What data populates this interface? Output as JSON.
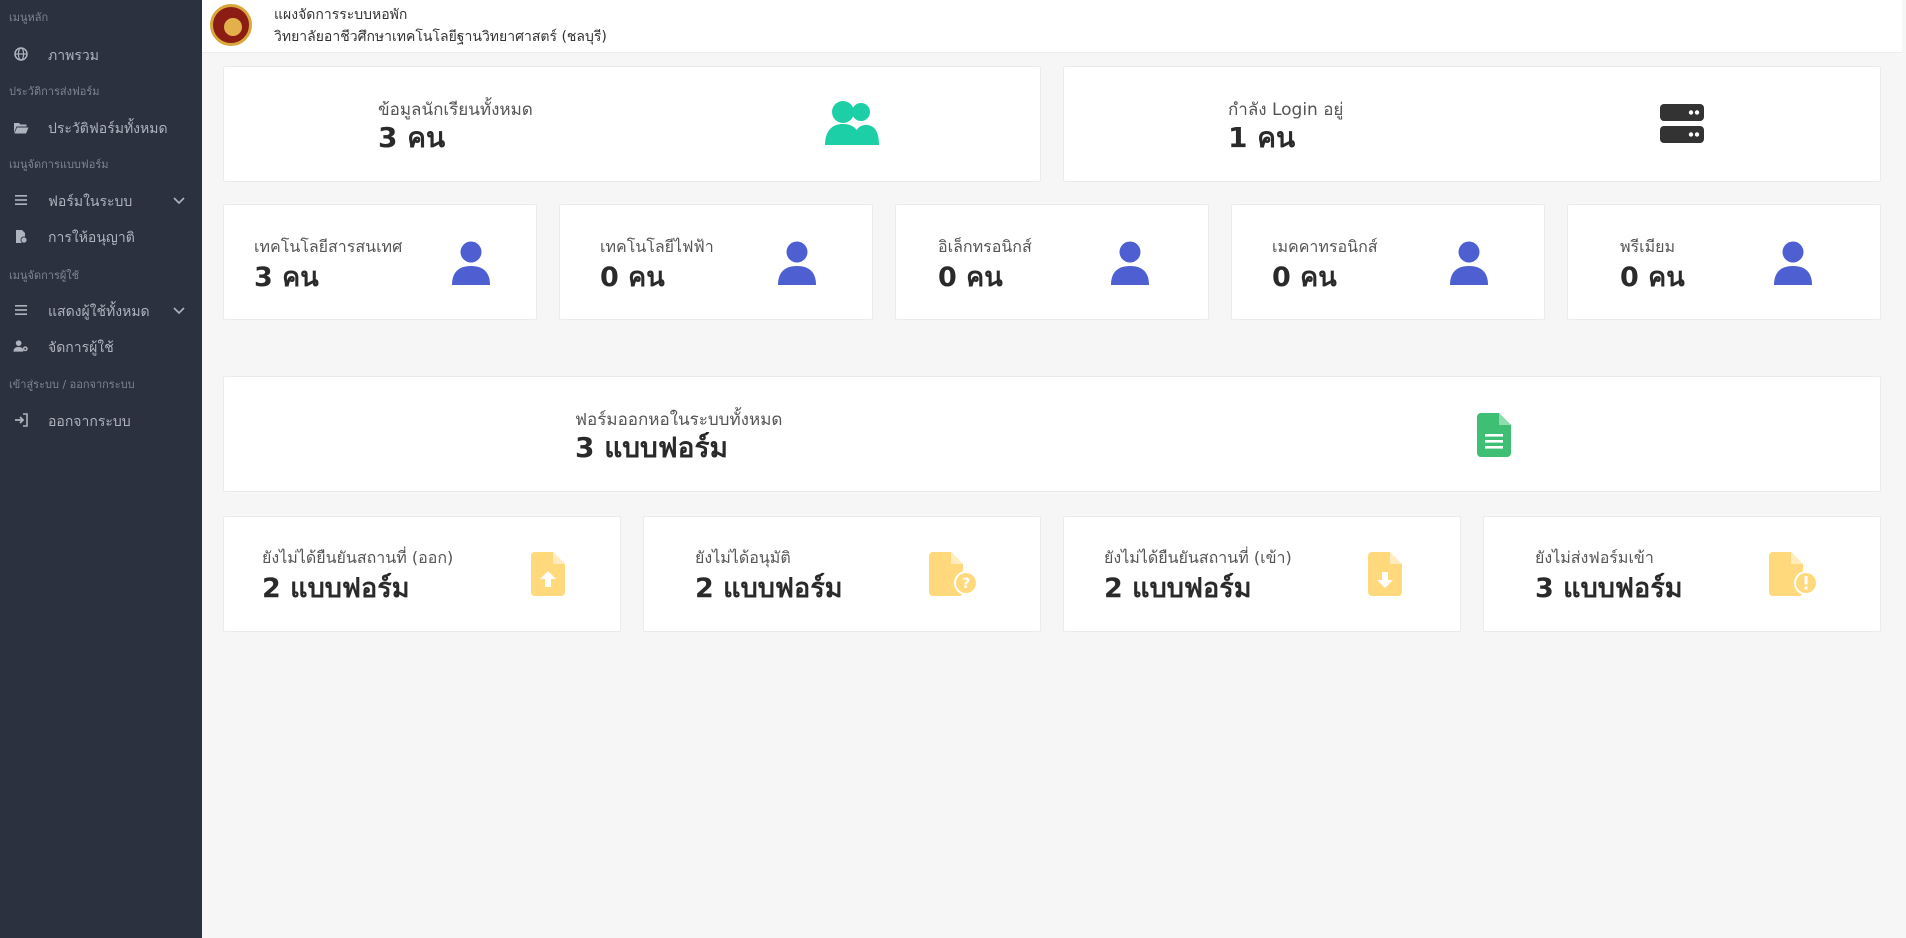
{
  "sidebar": {
    "sections": {
      "main": "เมนูหลัก",
      "history": "ประวัติการส่งฟอร์ม",
      "forms": "เมนูจัดการแบบฟอร์ม",
      "users": "เมนูจัดการผู้ใช้",
      "auth": "เข้าสู่ระบบ / ออกจากระบบ"
    },
    "items": [
      {
        "label": "ภาพรวม",
        "icon": "globe-icon"
      },
      {
        "label": "ประวัติฟอร์มทั้งหมด",
        "icon": "folder-open-icon"
      },
      {
        "label": "ฟอร์มในระบบ",
        "icon": "bars-icon"
      },
      {
        "label": "การให้อนุญาติ",
        "icon": "file-dollar-icon"
      },
      {
        "label": "แสดงผู้ใช้ทั้งหมด",
        "icon": "bars-icon"
      },
      {
        "label": "จัดการผู้ใช้",
        "icon": "user-gear-icon"
      },
      {
        "label": "ออกจากระบบ",
        "icon": "sign-in-icon"
      }
    ]
  },
  "header": {
    "title": "แผงจัดการระบบหอพัก",
    "subtitle": "วิทยาลัยอาชีวศึกษาเทคโนโลยีฐานวิทยาศาสตร์ (ชลบุรี)"
  },
  "stats": {
    "students": {
      "label": "ข้อมูลนักเรียนทั้งหมด",
      "value": "3 คน"
    },
    "online": {
      "label": "กำลัง Login อยู่",
      "value": "1 คน"
    },
    "departments": [
      {
        "label": "เทคโนโลยีสารสนเทศ",
        "value": "3 คน"
      },
      {
        "label": "เทคโนโลยีไฟฟ้า",
        "value": "0 คน"
      },
      {
        "label": "อิเล็กทรอนิกส์",
        "value": "0 คน"
      },
      {
        "label": "เมคคาทรอนิกส์",
        "value": "0 คน"
      },
      {
        "label": "พรีเมียม",
        "value": "0 คน"
      }
    ],
    "forms_total": {
      "label": "ฟอร์มออกหอในระบบทั้งหมด",
      "value": "3 แบบฟอร์ม"
    },
    "form_status": [
      {
        "label": "ยังไม่ได้ยืนยันสถานที่ (ออก)",
        "value": "2 แบบฟอร์ม"
      },
      {
        "label": "ยังไม่ได้อนุมัติ",
        "value": "2 แบบฟอร์ม"
      },
      {
        "label": "ยังไม่ได้ยืนยันสถานที่ (เข้า)",
        "value": "2 แบบฟอร์ม"
      },
      {
        "label": "ยังไม่ส่งฟอร์มเข้า",
        "value": "3 แบบฟอร์ม"
      }
    ]
  },
  "colors": {
    "sidebar_bg": "#2b313e",
    "teal": "#1ccfa6",
    "dark": "#333333",
    "blue": "#4e5fd2",
    "green": "#3fbf73",
    "yellow": "#ffd97c"
  }
}
